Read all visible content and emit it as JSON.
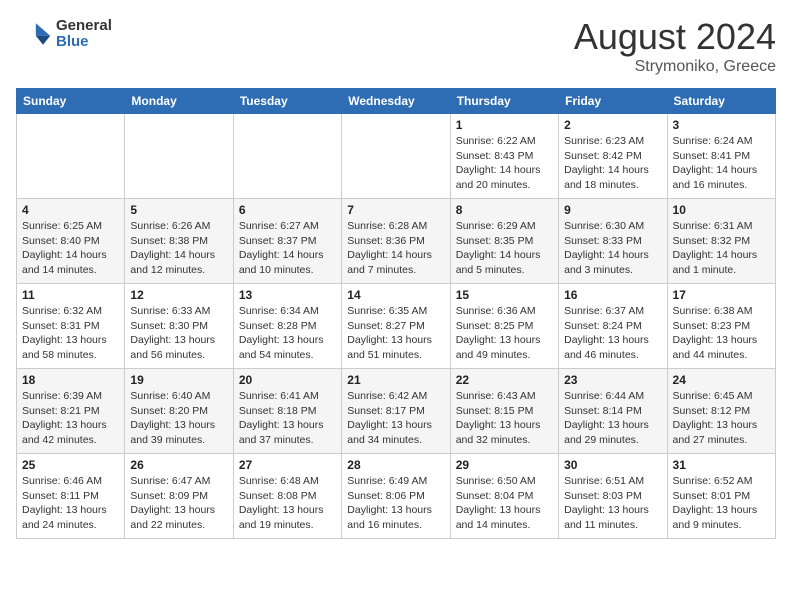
{
  "header": {
    "logo": {
      "general": "General",
      "blue": "Blue"
    },
    "title": "August 2024",
    "location": "Strymoniko, Greece"
  },
  "calendar": {
    "days_of_week": [
      "Sunday",
      "Monday",
      "Tuesday",
      "Wednesday",
      "Thursday",
      "Friday",
      "Saturday"
    ],
    "weeks": [
      [
        {
          "day": "",
          "detail": ""
        },
        {
          "day": "",
          "detail": ""
        },
        {
          "day": "",
          "detail": ""
        },
        {
          "day": "",
          "detail": ""
        },
        {
          "day": "1",
          "detail": "Sunrise: 6:22 AM\nSunset: 8:43 PM\nDaylight: 14 hours\nand 20 minutes."
        },
        {
          "day": "2",
          "detail": "Sunrise: 6:23 AM\nSunset: 8:42 PM\nDaylight: 14 hours\nand 18 minutes."
        },
        {
          "day": "3",
          "detail": "Sunrise: 6:24 AM\nSunset: 8:41 PM\nDaylight: 14 hours\nand 16 minutes."
        }
      ],
      [
        {
          "day": "4",
          "detail": "Sunrise: 6:25 AM\nSunset: 8:40 PM\nDaylight: 14 hours\nand 14 minutes."
        },
        {
          "day": "5",
          "detail": "Sunrise: 6:26 AM\nSunset: 8:38 PM\nDaylight: 14 hours\nand 12 minutes."
        },
        {
          "day": "6",
          "detail": "Sunrise: 6:27 AM\nSunset: 8:37 PM\nDaylight: 14 hours\nand 10 minutes."
        },
        {
          "day": "7",
          "detail": "Sunrise: 6:28 AM\nSunset: 8:36 PM\nDaylight: 14 hours\nand 7 minutes."
        },
        {
          "day": "8",
          "detail": "Sunrise: 6:29 AM\nSunset: 8:35 PM\nDaylight: 14 hours\nand 5 minutes."
        },
        {
          "day": "9",
          "detail": "Sunrise: 6:30 AM\nSunset: 8:33 PM\nDaylight: 14 hours\nand 3 minutes."
        },
        {
          "day": "10",
          "detail": "Sunrise: 6:31 AM\nSunset: 8:32 PM\nDaylight: 14 hours\nand 1 minute."
        }
      ],
      [
        {
          "day": "11",
          "detail": "Sunrise: 6:32 AM\nSunset: 8:31 PM\nDaylight: 13 hours\nand 58 minutes."
        },
        {
          "day": "12",
          "detail": "Sunrise: 6:33 AM\nSunset: 8:30 PM\nDaylight: 13 hours\nand 56 minutes."
        },
        {
          "day": "13",
          "detail": "Sunrise: 6:34 AM\nSunset: 8:28 PM\nDaylight: 13 hours\nand 54 minutes."
        },
        {
          "day": "14",
          "detail": "Sunrise: 6:35 AM\nSunset: 8:27 PM\nDaylight: 13 hours\nand 51 minutes."
        },
        {
          "day": "15",
          "detail": "Sunrise: 6:36 AM\nSunset: 8:25 PM\nDaylight: 13 hours\nand 49 minutes."
        },
        {
          "day": "16",
          "detail": "Sunrise: 6:37 AM\nSunset: 8:24 PM\nDaylight: 13 hours\nand 46 minutes."
        },
        {
          "day": "17",
          "detail": "Sunrise: 6:38 AM\nSunset: 8:23 PM\nDaylight: 13 hours\nand 44 minutes."
        }
      ],
      [
        {
          "day": "18",
          "detail": "Sunrise: 6:39 AM\nSunset: 8:21 PM\nDaylight: 13 hours\nand 42 minutes."
        },
        {
          "day": "19",
          "detail": "Sunrise: 6:40 AM\nSunset: 8:20 PM\nDaylight: 13 hours\nand 39 minutes."
        },
        {
          "day": "20",
          "detail": "Sunrise: 6:41 AM\nSunset: 8:18 PM\nDaylight: 13 hours\nand 37 minutes."
        },
        {
          "day": "21",
          "detail": "Sunrise: 6:42 AM\nSunset: 8:17 PM\nDaylight: 13 hours\nand 34 minutes."
        },
        {
          "day": "22",
          "detail": "Sunrise: 6:43 AM\nSunset: 8:15 PM\nDaylight: 13 hours\nand 32 minutes."
        },
        {
          "day": "23",
          "detail": "Sunrise: 6:44 AM\nSunset: 8:14 PM\nDaylight: 13 hours\nand 29 minutes."
        },
        {
          "day": "24",
          "detail": "Sunrise: 6:45 AM\nSunset: 8:12 PM\nDaylight: 13 hours\nand 27 minutes."
        }
      ],
      [
        {
          "day": "25",
          "detail": "Sunrise: 6:46 AM\nSunset: 8:11 PM\nDaylight: 13 hours\nand 24 minutes."
        },
        {
          "day": "26",
          "detail": "Sunrise: 6:47 AM\nSunset: 8:09 PM\nDaylight: 13 hours\nand 22 minutes."
        },
        {
          "day": "27",
          "detail": "Sunrise: 6:48 AM\nSunset: 8:08 PM\nDaylight: 13 hours\nand 19 minutes."
        },
        {
          "day": "28",
          "detail": "Sunrise: 6:49 AM\nSunset: 8:06 PM\nDaylight: 13 hours\nand 16 minutes."
        },
        {
          "day": "29",
          "detail": "Sunrise: 6:50 AM\nSunset: 8:04 PM\nDaylight: 13 hours\nand 14 minutes."
        },
        {
          "day": "30",
          "detail": "Sunrise: 6:51 AM\nSunset: 8:03 PM\nDaylight: 13 hours\nand 11 minutes."
        },
        {
          "day": "31",
          "detail": "Sunrise: 6:52 AM\nSunset: 8:01 PM\nDaylight: 13 hours\nand 9 minutes."
        }
      ]
    ]
  }
}
